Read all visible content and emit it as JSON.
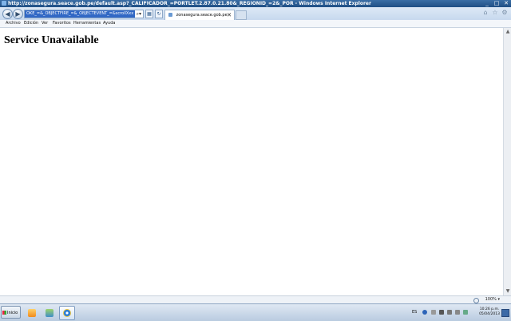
{
  "window": {
    "title": "http://zonasegura.seace.gob.pe/default.asp?_CALIFICADOR_=PORTLET.2.87.0.21.80&_REGIONID_=2&_POR - Windows Internet Explorer",
    "controls": {
      "minimize": "_",
      "maximize": "□",
      "close": "✕"
    }
  },
  "nav": {
    "back_icon": "back-icon",
    "forward_icon": "forward-icon",
    "address_value": "OKE_=&_OBJECTFIRE_=&_OBJECTEVENT_=&scrollXxx",
    "tab_label": "zonasegura.seace.gob.pe",
    "tab_close": "✕"
  },
  "menu": [
    "Archivo",
    "Edición",
    "Ver",
    "Favoritos",
    "Herramientas",
    "Ayuda"
  ],
  "page": {
    "heading": "Service Unavailable"
  },
  "status": {
    "zoom": "100%"
  },
  "taskbar": {
    "start_label": "Inicio",
    "language": "ES",
    "time": "10:26 p.m.",
    "date": "05/04/2013"
  }
}
